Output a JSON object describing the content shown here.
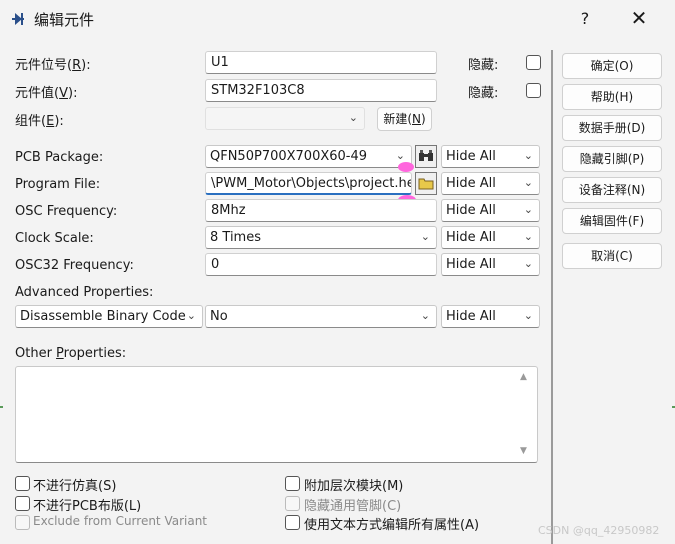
{
  "window": {
    "title": "编辑元件",
    "help_glyph": "?",
    "close_glyph": "✕"
  },
  "fields": {
    "ref_label": "元件位号",
    "ref_hotkey": "R",
    "ref_suffix": "):",
    "ref_value": "U1",
    "value_label": "元件值",
    "value_hotkey": "V",
    "value_suffix": "):",
    "value_value": "STM32F103C8",
    "group_label": "组件",
    "group_hotkey": "E",
    "group_suffix": "):",
    "hidden_label": "隐藏:",
    "new_button": "新建",
    "new_hotkey": "N",
    "paren_open": "(",
    "paren_close": ")"
  },
  "properties": [
    {
      "label": "PCB Package:",
      "value": "QFN50P700X700X60-49",
      "vis": "Hide All"
    },
    {
      "label": "Program File:",
      "value": "\\PWM_Motor\\Objects\\project.hex",
      "vis": "Hide All"
    },
    {
      "label": "OSC Frequency:",
      "value": "8Mhz",
      "vis": "Hide All"
    },
    {
      "label": "Clock Scale:",
      "value": "8 Times",
      "vis": "Hide All"
    },
    {
      "label": "OSC32 Frequency:",
      "value": "0",
      "vis": "Hide All"
    }
  ],
  "advanced": {
    "label": "Advanced Properties:",
    "name": "Disassemble Binary Code",
    "value": "No",
    "vis": "Hide All"
  },
  "other": {
    "label_pre": "Other ",
    "label_hot": "P",
    "label_post": "roperties:"
  },
  "checkboxes": {
    "no_sim": "不进行仿真(S)",
    "no_pcb": "不进行PCB布版(L)",
    "exclude_variant": "Exclude from Current Variant",
    "attach_hier": "附加层次模块(M)",
    "hide_pins": "隐藏通用管脚(C)",
    "edit_text": "使用文本方式编辑所有属性(A)"
  },
  "buttons": {
    "ok": "确定(O)",
    "help": "帮助(H)",
    "datasheet": "数据手册(D)",
    "hidden_pins": "隐藏引脚(P)",
    "edit_notes": "设备注释(N)",
    "edit_firmware": "编辑固件(F)",
    "cancel": "取消(C)"
  },
  "icons": {
    "binoculars": "binoculars-icon",
    "folder": "folder-icon",
    "chevron": "chevron-down-icon"
  },
  "watermark": "CSDN @qq_42950982",
  "colors": {
    "highlight_dot": "#ff66dd",
    "accent_underline": "#2a6fc0"
  }
}
